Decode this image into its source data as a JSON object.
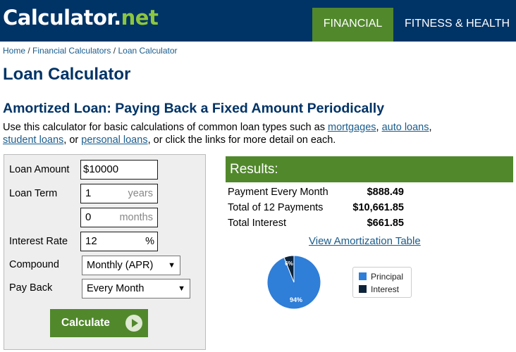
{
  "header": {
    "logo_main": "Calculator",
    "logo_dot": ".",
    "logo_net": "net",
    "nav": [
      "FINANCIAL",
      "FITNESS & HEALTH"
    ]
  },
  "breadcrumb": [
    "Home",
    "Financial Calculators",
    "Loan Calculator"
  ],
  "page_title": "Loan Calculator",
  "subtitle": "Amortized Loan: Paying Back a Fixed Amount Periodically",
  "intro": {
    "text1": "Use this calculator for basic calculations of common loan types such as ",
    "link1": "mortgages",
    "text2": ", ",
    "link2": "auto loans",
    "text3": ",",
    "link3": "student loans",
    "text4": ", or ",
    "link4": "personal loans",
    "text5": ", or click the links for more detail on each."
  },
  "form": {
    "loan_amount_label": "Loan Amount",
    "loan_amount_value": "$10000",
    "loan_term_label": "Loan Term",
    "years_value": "1",
    "years_unit": "years",
    "months_value": "0",
    "months_unit": "months",
    "interest_label": "Interest Rate",
    "interest_value": "12",
    "interest_unit": "%",
    "compound_label": "Compound",
    "compound_value": "Monthly (APR)",
    "payback_label": "Pay Back",
    "payback_value": "Every Month",
    "calculate_label": "Calculate"
  },
  "results": {
    "title": "Results:",
    "rows": [
      {
        "label": "Payment Every Month",
        "value": "$888.49"
      },
      {
        "label": "Total of 12 Payments",
        "value": "$10,661.85"
      },
      {
        "label": "Total Interest",
        "value": "$661.85"
      }
    ],
    "amortization_link": "View Amortization Table"
  },
  "chart_data": {
    "type": "pie",
    "slices": [
      {
        "name": "Principal",
        "value": 94,
        "label": "94%",
        "color": "#2f7ed8"
      },
      {
        "name": "Interest",
        "value": 6,
        "label": "6%",
        "color": "#0d233a"
      }
    ],
    "legend": [
      "Principal",
      "Interest"
    ],
    "legend_position": "right"
  }
}
